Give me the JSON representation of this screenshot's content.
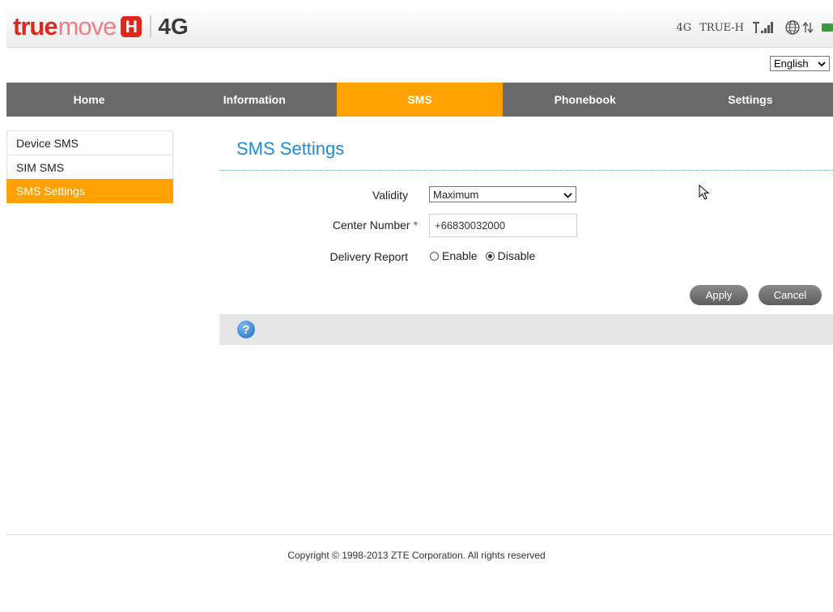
{
  "header": {
    "logo": {
      "true_text": "true",
      "move_text": "move",
      "h_text": "H",
      "network_text": "4G"
    },
    "status": {
      "network_type": "4G",
      "operator": "TRUE-H"
    },
    "icons": [
      "signal-icon",
      "globe-icon",
      "data-transfer-icon",
      "battery-icon"
    ]
  },
  "language": {
    "selected": "English"
  },
  "nav": {
    "items": [
      {
        "label": "Home"
      },
      {
        "label": "Information"
      },
      {
        "label": "SMS",
        "active": true
      },
      {
        "label": "Phonebook"
      },
      {
        "label": "Settings"
      }
    ]
  },
  "sidebar": {
    "items": [
      {
        "label": "Device SMS"
      },
      {
        "label": "SIM SMS"
      },
      {
        "label": "SMS Settings",
        "active": true
      }
    ]
  },
  "main": {
    "title": "SMS Settings",
    "validity": {
      "label": "Validity",
      "value": "Maximum"
    },
    "center_number": {
      "label": "Center Number",
      "required_mark": "*",
      "value": "+66830032000"
    },
    "delivery_report": {
      "label": "Delivery Report",
      "options": [
        {
          "label": "Enable",
          "checked": false
        },
        {
          "label": "Disable",
          "checked": true
        }
      ]
    },
    "apply_label": "Apply",
    "cancel_label": "Cancel"
  },
  "footer": {
    "copyright": "Copyright © 1998-2013 ZTE Corporation. All rights reserved"
  },
  "colors": {
    "accent": "#ffa201",
    "nav_bg": "#6a6a6a",
    "title": "#1f8ad6",
    "brand_red": "#e1261c"
  }
}
